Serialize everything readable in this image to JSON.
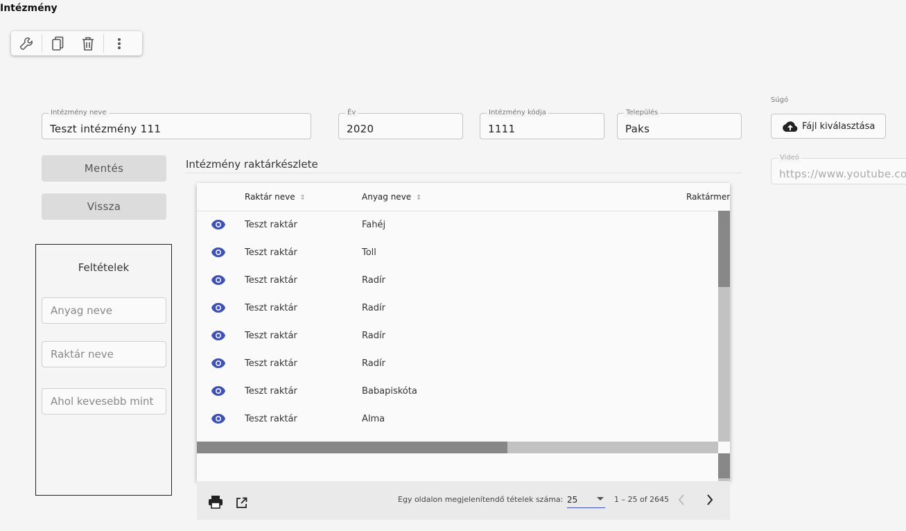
{
  "page": {
    "title": "Intézmény"
  },
  "toolbar": {
    "icons": [
      "wrench-icon",
      "copy-icon",
      "delete-icon",
      "more-vert-icon"
    ]
  },
  "form": {
    "name": {
      "label": "Intézmény neve",
      "value": "Teszt intézmény 111"
    },
    "year": {
      "label": "Év",
      "value": "2020"
    },
    "code": {
      "label": "Intézmény kódja",
      "value": "1111"
    },
    "town": {
      "label": "Település",
      "value": "Paks"
    }
  },
  "actions": {
    "save": "Mentés",
    "back": "Vissza"
  },
  "filters": {
    "title": "Feltételek",
    "material_placeholder": "Anyag neve",
    "warehouse_placeholder": "Raktár neve",
    "less_than_placeholder": "Ahol kevesebb mint"
  },
  "inventory": {
    "title": "Intézmény raktárkészlete",
    "columns": [
      "Raktár neve",
      "Anyag neve",
      "Raktármen"
    ],
    "rows": [
      {
        "warehouse": "Teszt raktár",
        "material": "Fahéj"
      },
      {
        "warehouse": "Teszt raktár",
        "material": "Toll"
      },
      {
        "warehouse": "Teszt raktár",
        "material": "Radír"
      },
      {
        "warehouse": "Teszt raktár",
        "material": "Radír"
      },
      {
        "warehouse": "Teszt raktár",
        "material": "Radír"
      },
      {
        "warehouse": "Teszt raktár",
        "material": "Radír"
      },
      {
        "warehouse": "Teszt raktár",
        "material": "Babapiskóta"
      },
      {
        "warehouse": "Teszt raktár",
        "material": "Alma"
      }
    ]
  },
  "paginator": {
    "items_per_page_label": "Egy oldalon megjelenítendő tételek száma:",
    "page_size": "25",
    "range": "1 – 25 of 2645"
  },
  "help": {
    "label": "Súgó",
    "file_button": "Fájl kiválasztása",
    "video_label": "Videó",
    "video_placeholder": "https://www.youtube.com"
  },
  "colors": {
    "accent": "#3f51b5",
    "button_grey": "#dcdcdc"
  }
}
